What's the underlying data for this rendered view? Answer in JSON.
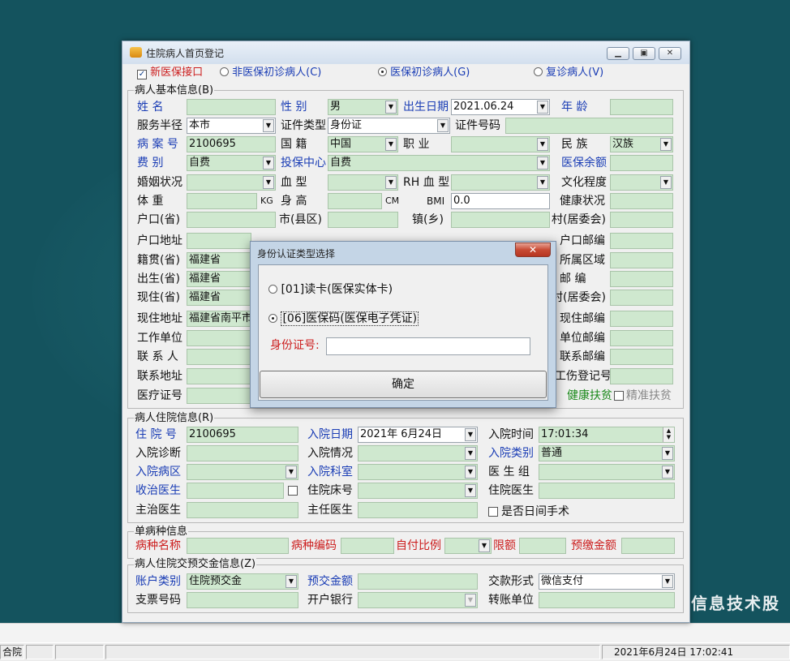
{
  "window": {
    "title": "住院病人首页登记"
  },
  "top_row": {
    "new_insurance_label": "新医保接口",
    "new_insurance_checked": true,
    "radios": [
      {
        "label": "非医保初诊病人(C)",
        "selected": false
      },
      {
        "label": "医保初诊病人(G)",
        "selected": true
      },
      {
        "label": "复诊病人(V)",
        "selected": false
      }
    ]
  },
  "basic_info": {
    "group_title": "病人基本信息(B)",
    "name_label": "姓    名",
    "name_value": "",
    "sex_label": "性    别",
    "sex_value": "男",
    "birth_label": "出生日期",
    "birth_value": "2021.06.24",
    "age_label": "年    龄",
    "age_value": "",
    "service_label": "服务半径",
    "service_value": "本市",
    "id_type_label": "证件类型",
    "id_type_value": "身份证",
    "id_no_label": "证件号码",
    "id_no_value": "",
    "case_no_label": "病 案 号",
    "case_no_value": "2100695",
    "nation_label": "国    籍",
    "nation_value": "中国",
    "job_label": "职    业",
    "job_value": "",
    "ethnic_label": "民    族",
    "ethnic_value": "汉族",
    "fee_label": "费    别",
    "fee_value": "自费",
    "center_label": "投保中心",
    "center_value": "自费",
    "balance_label": "医保余额",
    "balance_value": "",
    "marital_label": "婚姻状况",
    "marital_value": "",
    "blood_label": "血    型",
    "blood_value": "",
    "rh_label": "RH 血 型",
    "rh_value": "",
    "edu_label": "文化程度",
    "edu_value": "",
    "weight_label": "体    重",
    "weight_value": "",
    "weight_unit": "KG",
    "height_label": "身    高",
    "height_value": "",
    "height_unit": "CM",
    "bmi_label": "BMI",
    "bmi_value": "0.0",
    "health_label": "健康状况",
    "health_value": "",
    "hukou_prov_label": "户口(省)",
    "hukou_prov_value": "",
    "city_label": "市(县区)",
    "city_value": "",
    "town_label": "镇(乡)",
    "town_value": "",
    "village_label": "村(居委会)",
    "village_value": "",
    "hukou_addr_label": "户口地址",
    "hukou_addr_value": "",
    "hukou_zip_label": "户口邮编",
    "hukou_zip_value": "",
    "native_label": "籍贯(省)",
    "native_value": "福建省",
    "area_label": "所属区域",
    "area_value": "",
    "birthplace_label": "出生(省)",
    "birthplace_value": "福建省",
    "zip_label": "邮    编",
    "zip_value": "",
    "current_label": "现住(省)",
    "current_value": "福建省",
    "village2_label": "村(居委会)",
    "village2_value": "",
    "current_addr_label": "现住地址",
    "current_addr_value": "福建省南平市",
    "current_zip_label": "现住邮编",
    "current_zip_value": "",
    "work_label": "工作单位",
    "work_value": "",
    "work_zip_label": "单位邮编",
    "work_zip_value": "",
    "contact_label": "联 系 人",
    "contact_value": "",
    "contact_zip_label": "联系邮编",
    "contact_zip_value": "",
    "contact_addr_label": "联系地址",
    "contact_addr_value": "",
    "injury_label": "工伤登记号",
    "injury_value": "",
    "med_card_label": "医疗证号",
    "med_card_value": "",
    "health_poverty_label": "健康扶贫",
    "precise_poverty_label": "精准扶贫"
  },
  "hospital_info": {
    "group_title": "病人住院信息(R)",
    "hosp_no_label": "住 院 号",
    "hosp_no_value": "2100695",
    "admit_date_label": "入院日期",
    "admit_date_value": "2021年 6月24日",
    "admit_time_label": "入院时间",
    "admit_time_value": "17:01:34",
    "diag_label": "入院诊断",
    "diag_value": "",
    "situation_label": "入院情况",
    "situation_value": "",
    "category_label": "入院类别",
    "category_value": "普通",
    "ward_label": "入院病区",
    "ward_value": "",
    "dept_label": "入院科室",
    "dept_value": "",
    "group_label": "医 生 组",
    "group_value": "",
    "doctor_label": "收治医生",
    "doctor_value": "",
    "bed_label": "住院床号",
    "bed_value": "",
    "hosp_doctor_label": "住院医生",
    "hosp_doctor_value": "",
    "attending_label": "主治医生",
    "attending_value": "",
    "chief_label": "主任医生",
    "chief_value": "",
    "daytime_label": "是否日间手术"
  },
  "single_disease": {
    "group_title": "单病种信息",
    "name_label": "病种名称",
    "name_value": "",
    "code_label": "病种编码",
    "code_value": "",
    "ratio_label": "自付比例",
    "ratio_value": "",
    "limit_label": "限额",
    "limit_value": "",
    "prepay_label": "预缴金额",
    "prepay_value": ""
  },
  "deposit": {
    "group_title": "病人住院交预交金信息(Z)",
    "account_label": "账户类别",
    "account_value": "住院预交金",
    "amount_label": "预交金额",
    "amount_value": "",
    "payment_label": "交款形式",
    "payment_value": "微信支付",
    "check_label": "支票号码",
    "check_value": "",
    "bank_label": "开户银行",
    "bank_value": "",
    "transfer_label": "转账单位",
    "transfer_value": ""
  },
  "dialog": {
    "title": "身份认证类型选择",
    "close_symbol": "✕",
    "option1": "[01]读卡(医保实体卡)",
    "option2": "[06]医保码(医保电子凭证)",
    "selected": 2,
    "id_label": "身份证号:",
    "id_value": "",
    "ok_label": "确定"
  },
  "desktop": {
    "company_text": "信息技术股"
  },
  "statusbar": {
    "left_text": "合院",
    "datetime": "2021年6月24日  17:02:41"
  },
  "colors": {
    "field_green": "#cfe8cf",
    "label_blue": "#1a3db5",
    "label_red": "#cc1d1d",
    "desktop": "#14535e"
  }
}
